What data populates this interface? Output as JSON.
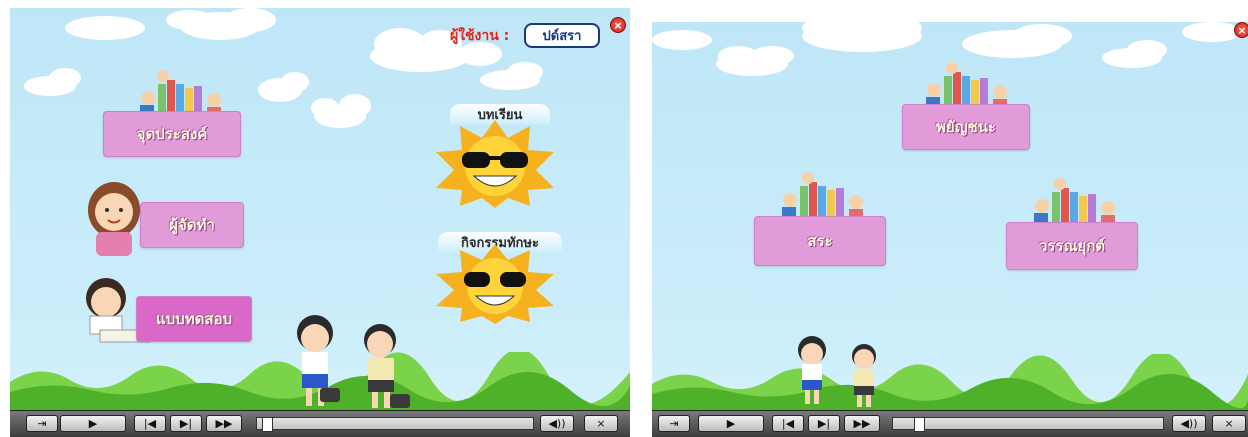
{
  "left_screen": {
    "user_label": "ผู้ใช้งาน :",
    "logout_button": "ปด์สรา",
    "close_icon": "×",
    "menu": {
      "objective": "จุดประสงค์",
      "author": "ผู้จัดทำ",
      "test": "แบบทดสอบ"
    },
    "suns": {
      "lesson": "บทเรียน",
      "activity": "กิจกรรมทักษะ"
    }
  },
  "right_screen": {
    "close_icon": "×",
    "menu": {
      "consonant": "พยัญชนะ",
      "vowel": "สระ",
      "tone": "วรรณยุกต์"
    }
  },
  "controls": {
    "exit": "⇥",
    "play": "▶",
    "prev": "|◀",
    "next": "▶|",
    "forward": "▶▶",
    "volume": "◀))",
    "close": "×",
    "progress_left": 0.02,
    "progress_right": 0.08
  },
  "colors": {
    "sky": "#c7ebf9",
    "pink": "#e29bd9",
    "grass": "#5fc23a",
    "user_label": "#e0261e"
  }
}
